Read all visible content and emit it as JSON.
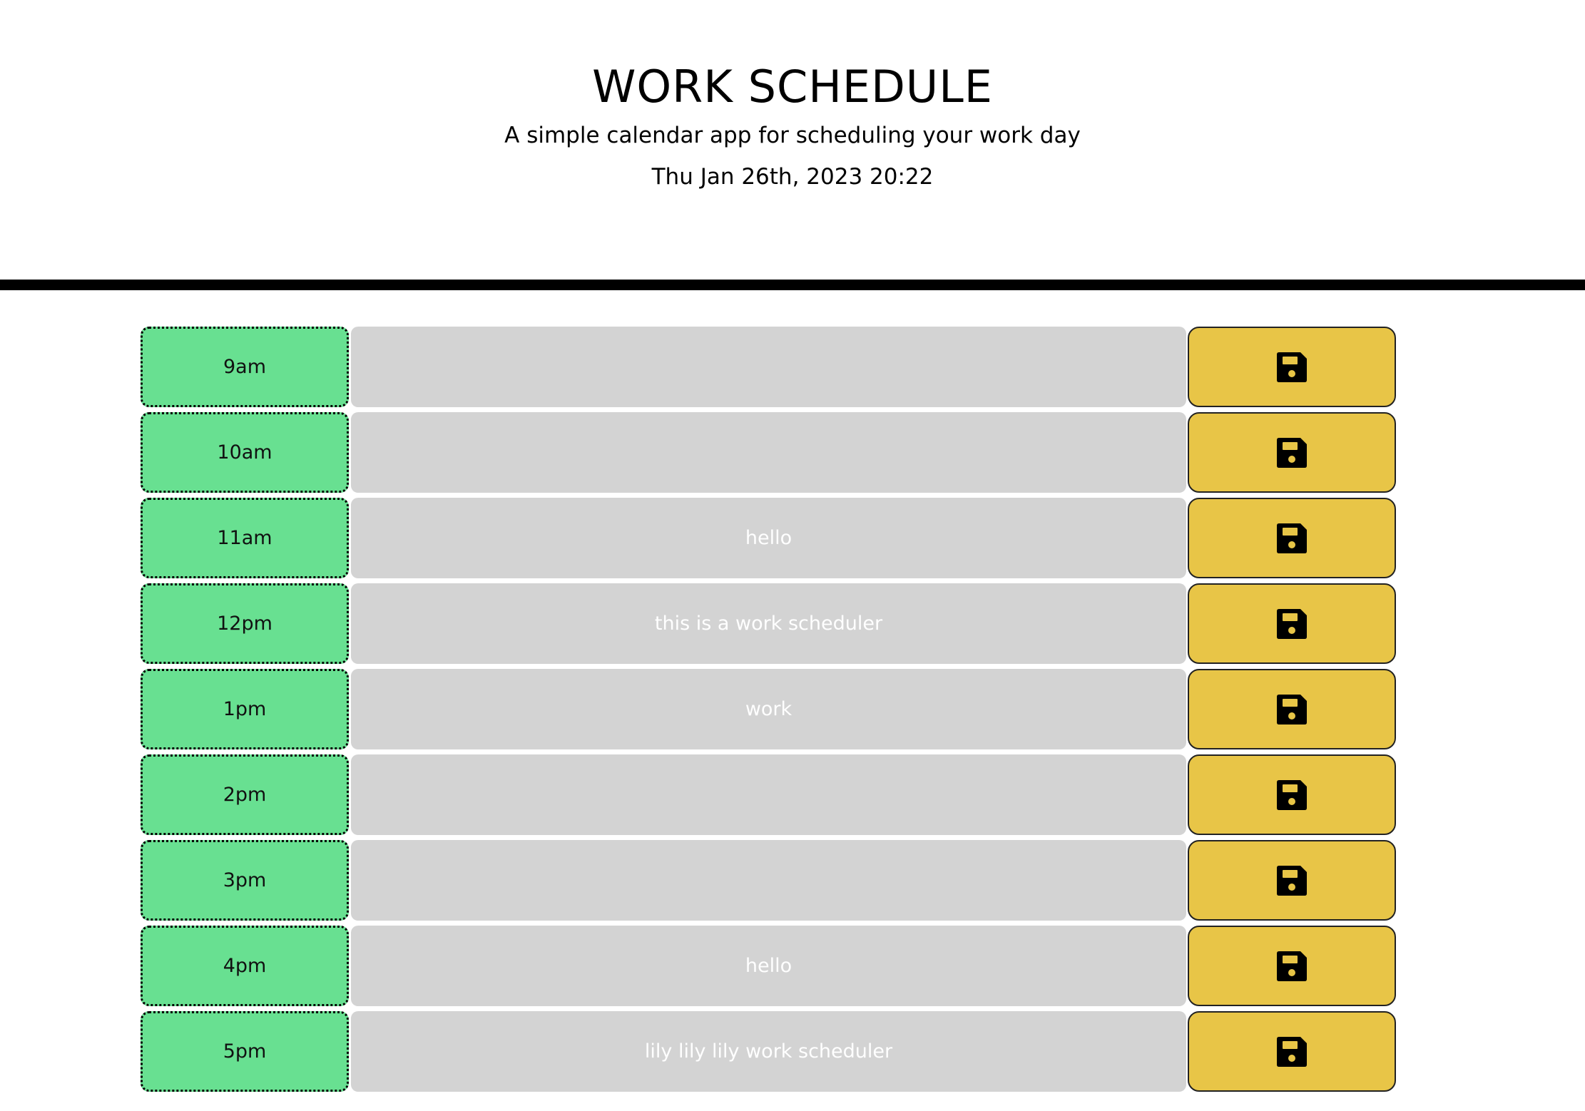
{
  "header": {
    "title": "WORK SCHEDULE",
    "subtitle": "A simple calendar app for scheduling your work day",
    "current_date": "Thu Jan 26th, 2023 20:22"
  },
  "colors": {
    "hour_bg": "#68e091",
    "task_bg": "#d3d3d3",
    "save_bg": "#e8c547"
  },
  "save_icon": "floppy-disk-icon",
  "rows": [
    {
      "hour": "9am",
      "task": ""
    },
    {
      "hour": "10am",
      "task": ""
    },
    {
      "hour": "11am",
      "task": "hello"
    },
    {
      "hour": "12pm",
      "task": "this is a work scheduler"
    },
    {
      "hour": "1pm",
      "task": "work"
    },
    {
      "hour": "2pm",
      "task": ""
    },
    {
      "hour": "3pm",
      "task": ""
    },
    {
      "hour": "4pm",
      "task": "hello"
    },
    {
      "hour": "5pm",
      "task": "lily lily lily  work scheduler"
    }
  ]
}
